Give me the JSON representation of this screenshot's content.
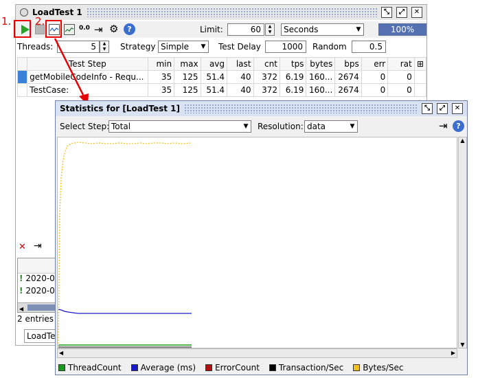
{
  "main_window": {
    "title": "LoadTest 1",
    "limit_label": "Limit:",
    "limit_value": "60",
    "limit_unit": "Seconds",
    "progress_label": "100%",
    "progress": 1.0,
    "threads_label": "Threads:",
    "threads_value": "5",
    "strategy_label": "Strategy",
    "strategy_value": "Simple",
    "test_delay_label": "Test Delay",
    "test_delay_value": "1000",
    "random_label": "Random",
    "random_value": "0.5",
    "table": {
      "columns": [
        "Test Step",
        "min",
        "max",
        "avg",
        "last",
        "cnt",
        "tps",
        "bytes",
        "bps",
        "err",
        "rat"
      ],
      "rows": [
        [
          "getMobileCodeInfo - Requ...",
          "35",
          "125",
          "51.4",
          "40",
          "372",
          "6.19",
          "160...",
          "2674",
          "0",
          "0"
        ],
        [
          "TestCase:",
          "35",
          "125",
          "51.4",
          "40",
          "372",
          "6.19",
          "160...",
          "2674",
          "0",
          "0"
        ]
      ]
    },
    "log_rows": [
      "2020-0",
      "2020-0"
    ],
    "entries_label": "2 entries",
    "bottom_tab": "LoadTest"
  },
  "annotations": {
    "step1": "1.",
    "step2": "2."
  },
  "stats_window": {
    "title": "Statistics for [LoadTest 1]",
    "select_step_label": "Select Step:",
    "select_step_value": "Total",
    "resolution_label": "Resolution:",
    "resolution_value": "data",
    "legend": [
      {
        "name": "ThreadCount",
        "color": "#1a9a1a"
      },
      {
        "name": "Average (ms)",
        "color": "#1a1acc"
      },
      {
        "name": "ErrorCount",
        "color": "#b01010"
      },
      {
        "name": "Transaction/Sec",
        "color": "#000000"
      },
      {
        "name": "Bytes/Sec",
        "color": "#f0c020"
      }
    ]
  },
  "colors": {
    "accent": "#5470b0",
    "annotation": "#e60000",
    "dots": "#8fa3c7"
  }
}
